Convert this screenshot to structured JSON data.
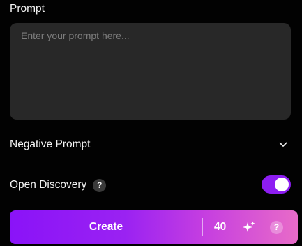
{
  "prompt": {
    "label": "Prompt",
    "placeholder": "Enter your prompt here...",
    "value": ""
  },
  "negative_prompt": {
    "label": "Negative Prompt",
    "icon": "chevron-down-icon"
  },
  "open_discovery": {
    "label": "Open Discovery",
    "help_glyph": "?",
    "toggle_on": true,
    "toggle_color": "#8d1df2"
  },
  "create_bar": {
    "label": "Create",
    "credits": "40",
    "sparkle_icon": "sparkle-icon",
    "help_glyph": "?",
    "gradient_start": "#8a13f8",
    "gradient_end": "#e86bc8"
  }
}
